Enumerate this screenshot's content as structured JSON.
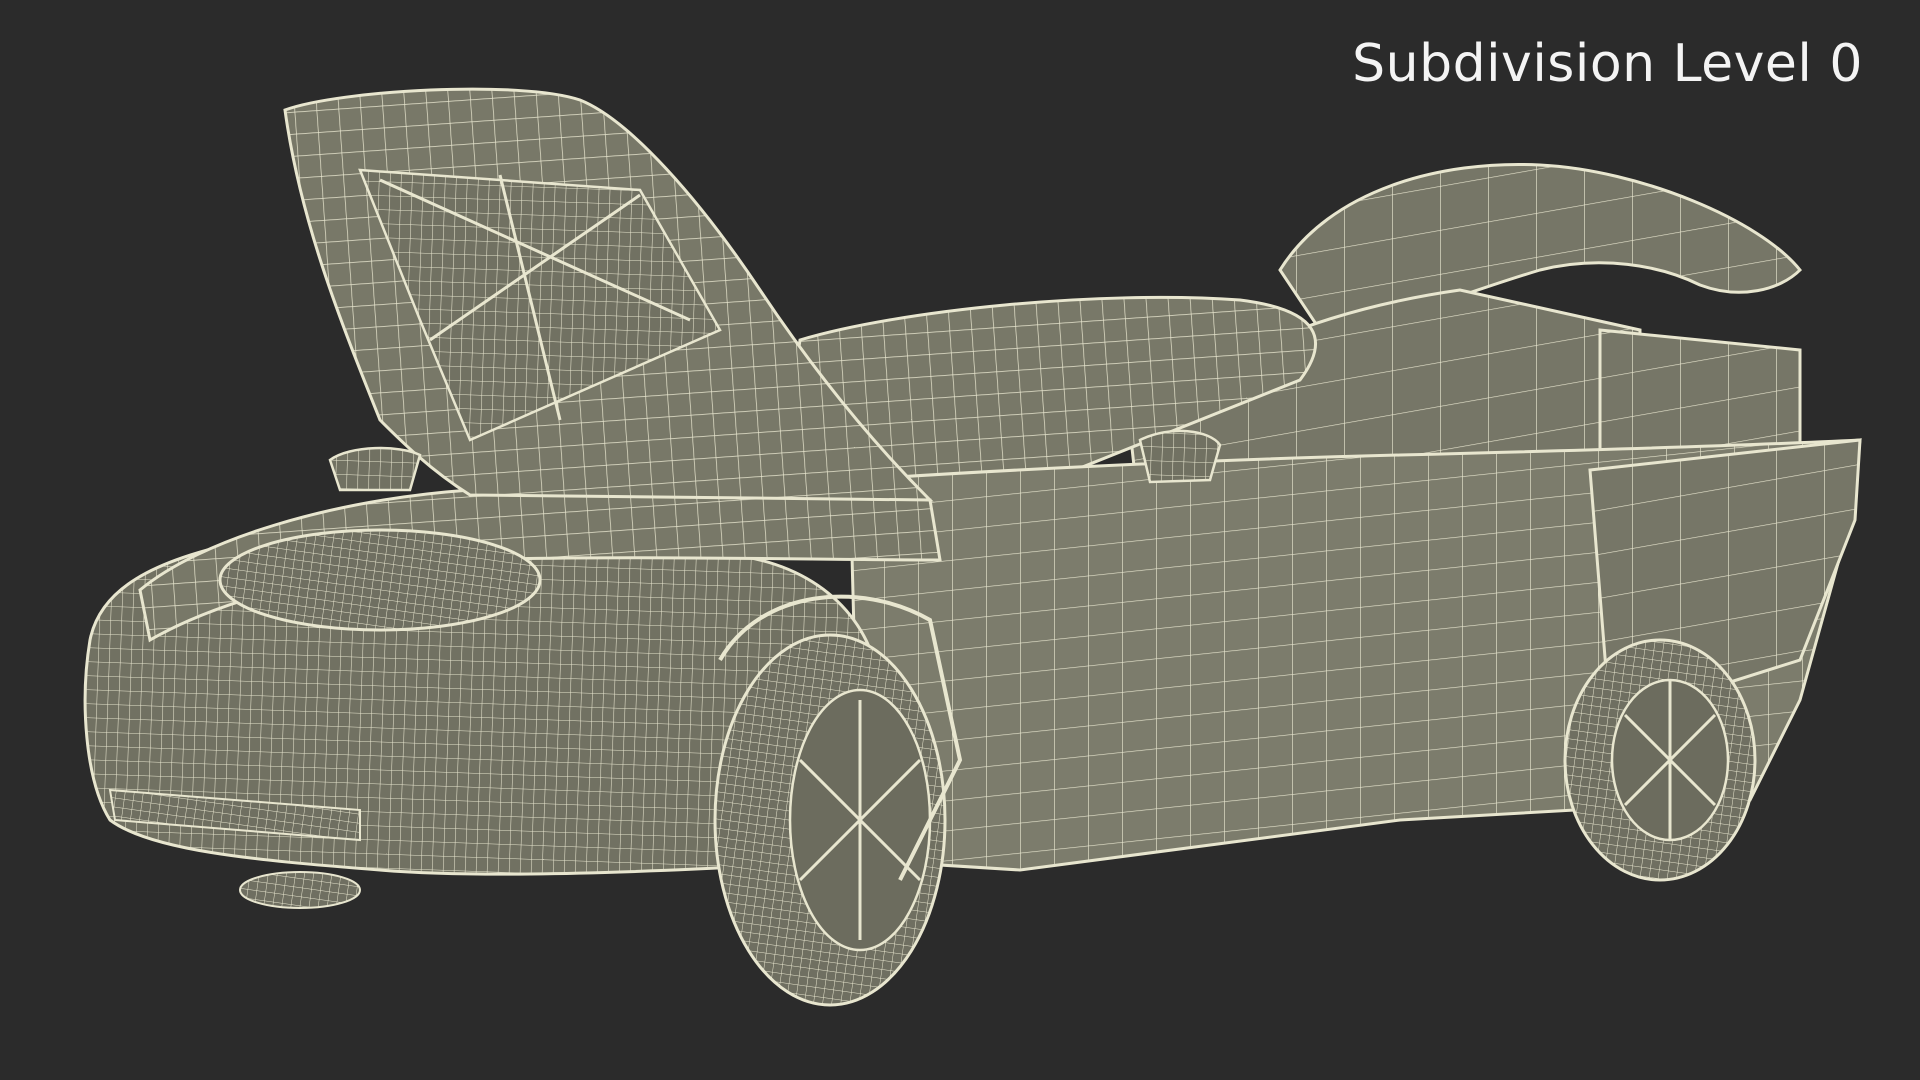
{
  "overlay": {
    "label": "Subdivision Level 0"
  },
  "colors": {
    "background": "#2b2b2b",
    "surface": "#7a7a6a",
    "wire": "#e8e6cf",
    "label": "#f4f4f4"
  },
  "scene": {
    "subject": "car-wireframe-icon"
  }
}
